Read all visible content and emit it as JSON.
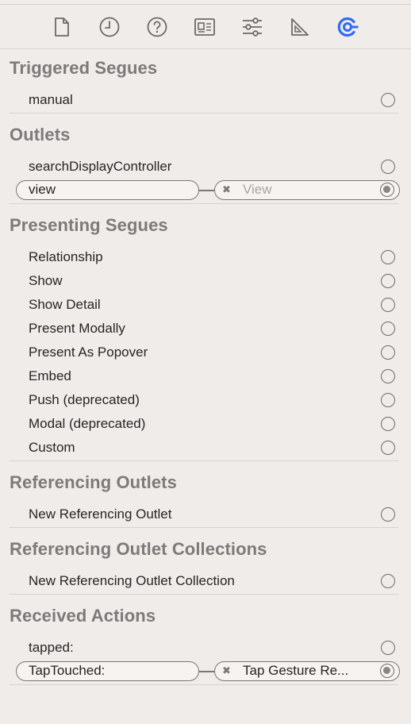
{
  "toolbar": {
    "icons": [
      {
        "name": "file-inspector-icon"
      },
      {
        "name": "history-inspector-icon"
      },
      {
        "name": "quick-help-icon"
      },
      {
        "name": "identity-inspector-icon"
      },
      {
        "name": "attributes-inspector-icon"
      },
      {
        "name": "size-inspector-icon"
      },
      {
        "name": "connections-inspector-icon",
        "active": true,
        "color": "#2f6cf0"
      }
    ]
  },
  "sections": {
    "triggered_segues": {
      "title": "Triggered Segues",
      "items": [
        "manual"
      ]
    },
    "outlets": {
      "title": "Outlets",
      "items": [
        "searchDisplayController"
      ],
      "connected": {
        "label": "view",
        "target": "View"
      }
    },
    "presenting_segues": {
      "title": "Presenting Segues",
      "items": [
        "Relationship",
        "Show",
        "Show Detail",
        "Present Modally",
        "Present As Popover",
        "Embed",
        "Push (deprecated)",
        "Modal (deprecated)",
        "Custom"
      ]
    },
    "referencing_outlets": {
      "title": "Referencing Outlets",
      "items": [
        "New Referencing Outlet"
      ]
    },
    "referencing_outlet_collections": {
      "title": "Referencing Outlet Collections",
      "items": [
        "New Referencing Outlet Collection"
      ]
    },
    "received_actions": {
      "title": "Received Actions",
      "items": [
        "tapped:"
      ],
      "connected": {
        "label": "TapTouched:",
        "target": "Tap Gesture Re..."
      }
    }
  },
  "colors": {
    "accent": "#2f6cf0",
    "section_title": "#7e7a79",
    "background": "#f0ecea"
  }
}
